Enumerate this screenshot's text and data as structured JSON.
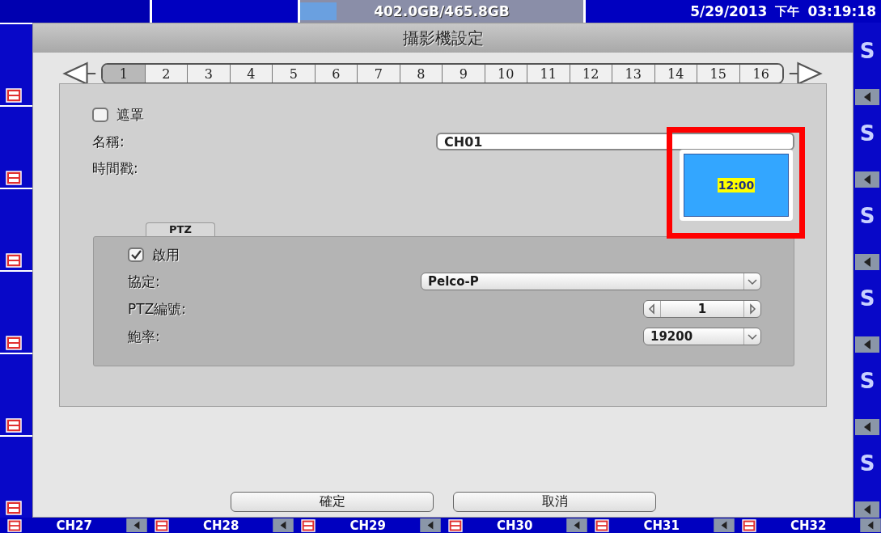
{
  "top_bar": {
    "disk_usage": "402.0GB/465.8GB",
    "date": "5/29/2013",
    "period": "下午",
    "time": "03:19:18"
  },
  "dialog": {
    "title": "攝影機設定",
    "camera_tabs": [
      {
        "label": "1",
        "selected": true
      },
      {
        "label": "2",
        "selected": false
      },
      {
        "label": "3",
        "selected": false
      },
      {
        "label": "4",
        "selected": false
      },
      {
        "label": "5",
        "selected": false
      },
      {
        "label": "6",
        "selected": false
      },
      {
        "label": "7",
        "selected": false
      },
      {
        "label": "8",
        "selected": false
      },
      {
        "label": "9",
        "selected": false
      },
      {
        "label": "10",
        "selected": false
      },
      {
        "label": "11",
        "selected": false
      },
      {
        "label": "12",
        "selected": false
      },
      {
        "label": "13",
        "selected": false
      },
      {
        "label": "14",
        "selected": false
      },
      {
        "label": "15",
        "selected": false
      },
      {
        "label": "16",
        "selected": false
      }
    ],
    "mask": {
      "label": "遮罩",
      "checked": false
    },
    "name": {
      "label": "名稱:",
      "value": "CH01"
    },
    "timestamp": {
      "label": "時間戳:",
      "preview_time": "12:00"
    },
    "ptz": {
      "tab": "PTZ",
      "enable": {
        "label": "啟用",
        "checked": true
      },
      "protocol": {
        "label": "協定:",
        "value": "Pelco-P"
      },
      "ptz_id": {
        "label": "PTZ編號:",
        "value": "1"
      },
      "baud_rate": {
        "label": "鮑率:",
        "value": "19200"
      }
    },
    "buttons": [
      "確定",
      "取消"
    ]
  },
  "side_tiles": [
    {
      "logo": "S"
    },
    {
      "logo": "S"
    },
    {
      "logo": "S"
    },
    {
      "logo": "S"
    },
    {
      "logo": "S"
    },
    {
      "logo": "S"
    }
  ],
  "channels": [
    "CH27",
    "CH28",
    "CH29",
    "CH30",
    "CH31",
    "CH32"
  ]
}
